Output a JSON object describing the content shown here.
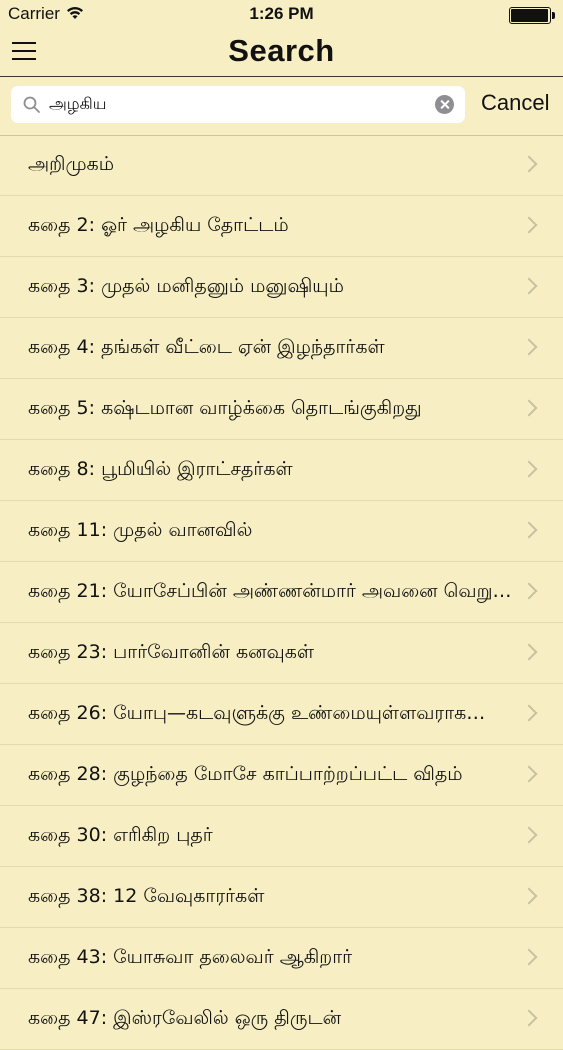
{
  "status_bar": {
    "carrier": "Carrier",
    "time": "1:26 PM"
  },
  "nav": {
    "title": "Search"
  },
  "search": {
    "value": "அழகிய",
    "cancel_label": "Cancel"
  },
  "results": [
    {
      "label": "அறிமுகம்"
    },
    {
      "label": "கதை 2: ஓர் அழகிய தோட்டம்"
    },
    {
      "label": "கதை 3: முதல் மனிதனும் மனுஷியும்"
    },
    {
      "label": "கதை 4: தங்கள் வீட்டை ஏன் இழந்தார்கள்"
    },
    {
      "label": "கதை 5: கஷ்டமான வாழ்க்கை தொடங்குகிறது"
    },
    {
      "label": "கதை 8: பூமியில் இராட்சதர்கள்"
    },
    {
      "label": "கதை 11: முதல் வானவில்"
    },
    {
      "label": "கதை 21: யோசேப்பின் அண்ணன்மார் அவனை வெறு…"
    },
    {
      "label": "கதை 23: பார்வோனின் கனவுகள்"
    },
    {
      "label": "கதை 26: யோபு—கடவுளுக்கு உண்மையுள்ளவராக…"
    },
    {
      "label": "கதை 28: குழந்தை மோசே காப்பாற்றப்பட்ட விதம்"
    },
    {
      "label": "கதை 30: எரிகிற புதர்"
    },
    {
      "label": "கதை 38: 12 வேவுகாரர்கள்"
    },
    {
      "label": "கதை 43: யோசுவா தலைவர் ஆகிறார்"
    },
    {
      "label": "கதை 47: இஸ்ரவேலில் ஒரு திருடன்"
    }
  ]
}
